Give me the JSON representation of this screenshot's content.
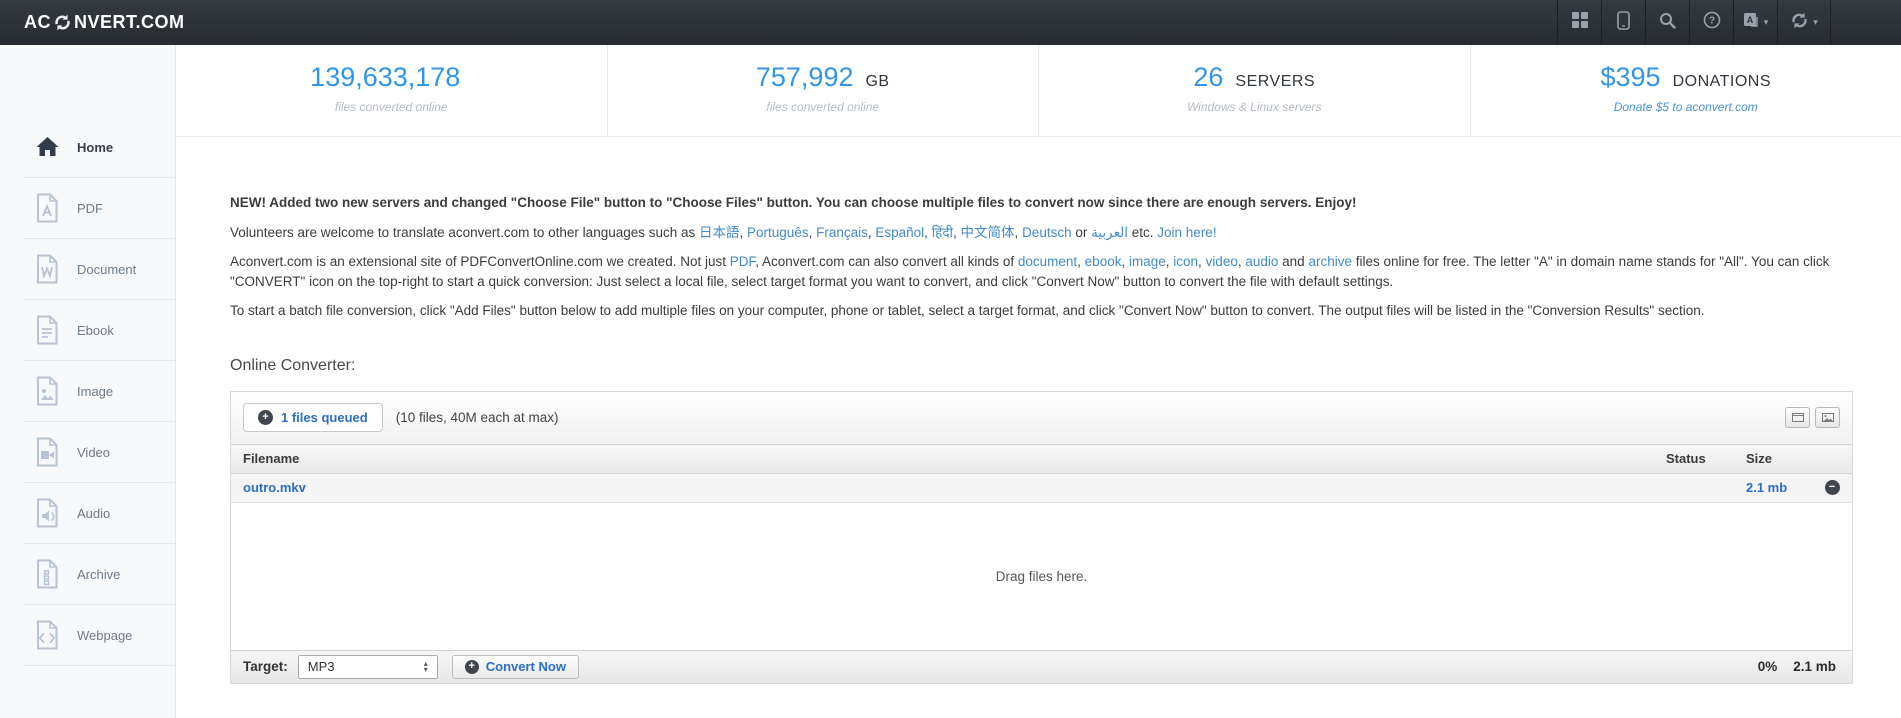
{
  "icons": {
    "plus": "+",
    "minus": "−",
    "caret_down": "▾",
    "caret_up": "▴"
  },
  "colors": {
    "accent_blue": "#3295e6",
    "link_blue": "#428bca",
    "file_link_blue": "#2a6fc4",
    "navbar_bg": "#272b30"
  },
  "navbar": {
    "brand_prefix": "AC",
    "brand_suffix": "NVERT.COM"
  },
  "stats": [
    {
      "value": "139,633,178",
      "unit": "",
      "subtitle": "files converted online"
    },
    {
      "value": "757,992",
      "unit": "GB",
      "subtitle": "files converted online"
    },
    {
      "value": "26",
      "unit": "SERVERS",
      "subtitle": "Windows & Linux servers"
    },
    {
      "value": "$395",
      "unit": "DONATIONS",
      "subtitle": "Donate $5 to aconvert.com"
    }
  ],
  "sidebar": {
    "items": [
      {
        "label": "Home",
        "icon": "home-icon",
        "active": true
      },
      {
        "label": "PDF",
        "icon": "pdf-file-icon"
      },
      {
        "label": "Document",
        "icon": "word-file-icon"
      },
      {
        "label": "Ebook",
        "icon": "ebook-file-icon"
      },
      {
        "label": "Image",
        "icon": "image-file-icon"
      },
      {
        "label": "Video",
        "icon": "video-file-icon"
      },
      {
        "label": "Audio",
        "icon": "audio-file-icon"
      },
      {
        "label": "Archive",
        "icon": "archive-file-icon"
      },
      {
        "label": "Webpage",
        "icon": "webpage-file-icon"
      }
    ]
  },
  "content": {
    "announcement": "NEW! Added two new servers and changed \"Choose File\" button to \"Choose Files\" button. You can choose multiple files to convert now since there are enough servers. Enjoy!",
    "p_volunteer": [
      {
        "t": "Volunteers are welcome to translate aconvert.com to other languages such as "
      },
      {
        "t": "日本語",
        "link": true
      },
      {
        "t": ", "
      },
      {
        "t": "Português",
        "link": true
      },
      {
        "t": ", "
      },
      {
        "t": "Français",
        "link": true
      },
      {
        "t": ", "
      },
      {
        "t": "Español",
        "link": true
      },
      {
        "t": ", "
      },
      {
        "t": "हिंदी",
        "link": true
      },
      {
        "t": ", "
      },
      {
        "t": "中文简体",
        "link": true
      },
      {
        "t": ", "
      },
      {
        "t": "Deutsch",
        "link": true
      },
      {
        "t": " or "
      },
      {
        "t": "العربية",
        "link": true
      },
      {
        "t": " etc. "
      },
      {
        "t": "Join here!",
        "link": true
      }
    ],
    "p_about": [
      {
        "t": "Aconvert.com is an extensional site of PDFConvertOnline.com we created. Not just "
      },
      {
        "t": "PDF",
        "link": true
      },
      {
        "t": ", Aconvert.com can also convert all kinds of "
      },
      {
        "t": "document",
        "link": true
      },
      {
        "t": ", "
      },
      {
        "t": "ebook",
        "link": true
      },
      {
        "t": ", "
      },
      {
        "t": "image",
        "link": true
      },
      {
        "t": ", "
      },
      {
        "t": "icon",
        "link": true
      },
      {
        "t": ", "
      },
      {
        "t": "video",
        "link": true
      },
      {
        "t": ", "
      },
      {
        "t": "audio",
        "link": true
      },
      {
        "t": " and "
      },
      {
        "t": "archive",
        "link": true
      },
      {
        "t": " files online for free. The letter \"A\" in domain name stands for \"All\". You can click \"CONVERT\" icon on the top-right to start a quick conversion: Just select a local file, select target format you want to convert, and click \"Convert Now\" button to convert the file with default settings."
      }
    ],
    "p_batch": "To start a batch file conversion, click \"Add Files\" button below to add multiple files on your computer, phone or tablet, select a target format, and click \"Convert Now\" button to convert. The output files will be listed in the \"Conversion Results\" section.",
    "section_title": "Online Converter:"
  },
  "converter": {
    "queued_button": "1 files queued",
    "limit_note": "(10 files, 40M each at max)",
    "table": {
      "headers": [
        "Filename",
        "Status",
        "Size"
      ],
      "rows": [
        {
          "filename": "outro.mkv",
          "status": "",
          "size": "2.1 mb"
        }
      ]
    },
    "drop_hint": "Drag files here.",
    "target_label": "Target:",
    "target_value": "MP3",
    "convert_button": "Convert Now",
    "progress": "0%",
    "total_size": "2.1 mb"
  }
}
